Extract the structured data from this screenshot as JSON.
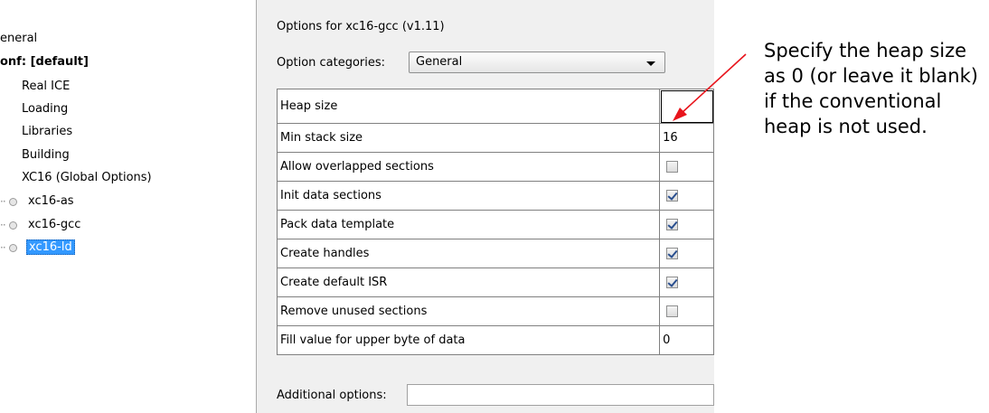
{
  "tree": {
    "items": [
      {
        "label": "eneral"
      },
      {
        "label": "onf: [default]"
      },
      {
        "label": "Real ICE"
      },
      {
        "label": "Loading"
      },
      {
        "label": "Libraries"
      },
      {
        "label": "Building"
      },
      {
        "label": "XC16 (Global Options)"
      },
      {
        "label": "xc16-as"
      },
      {
        "label": "xc16-gcc"
      },
      {
        "label": "xc16-ld",
        "selected": true
      }
    ]
  },
  "panel": {
    "title": "Options for xc16-gcc (v1.11)",
    "category_label": "Option categories:",
    "category_value": "General",
    "options": [
      {
        "name": "Heap size",
        "value": ""
      },
      {
        "name": "Min stack size",
        "value": "16"
      },
      {
        "name": "Allow overlapped sections",
        "checked": false
      },
      {
        "name": "Init data sections",
        "checked": true
      },
      {
        "name": "Pack data template",
        "checked": true
      },
      {
        "name": "Create handles",
        "checked": true
      },
      {
        "name": "Create default ISR",
        "checked": true
      },
      {
        "name": "Remove unused sections",
        "checked": false
      },
      {
        "name": "Fill value for upper byte of data",
        "value": "0"
      }
    ],
    "additional_label": "Additional options:",
    "additional_value": ""
  },
  "annotation": {
    "text": "Specify the heap size as 0 (or leave it blank) if the conventional heap is not used.",
    "arrow_color": "#e8141c"
  }
}
